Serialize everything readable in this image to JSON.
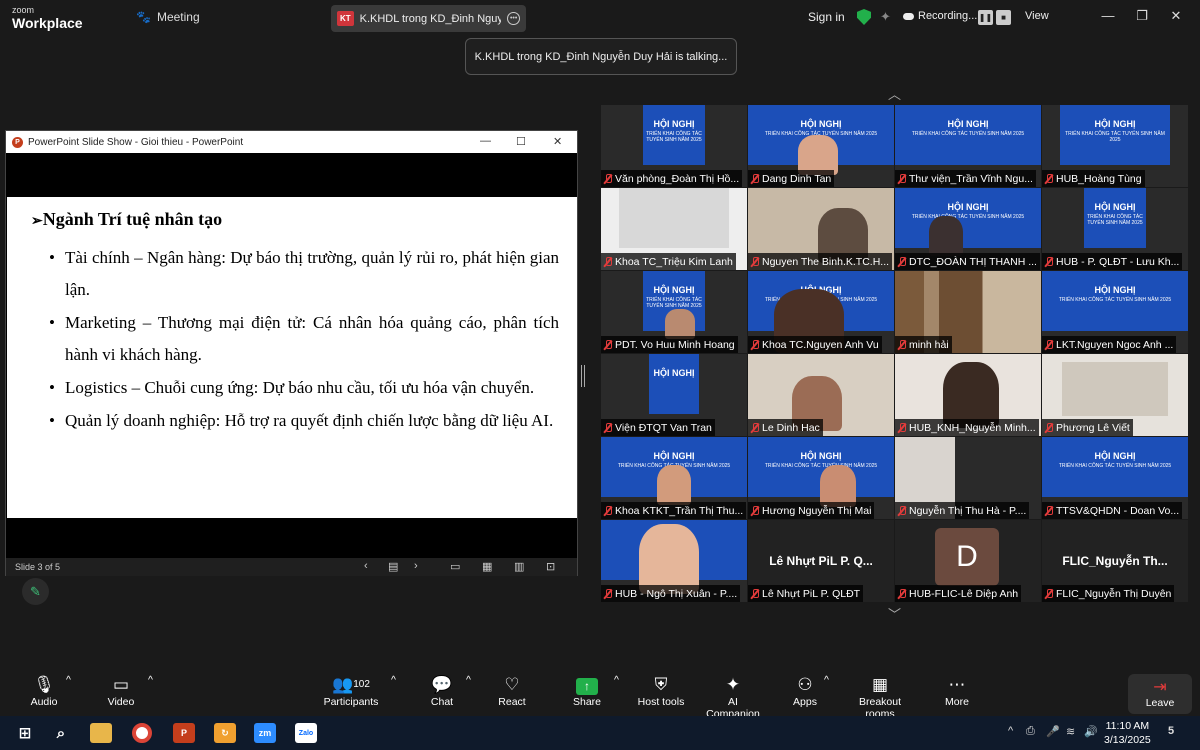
{
  "app": {
    "logo_line1": "zoom",
    "logo_line2": "Workplace",
    "meeting_label": "Meeting",
    "meeting_tab": "K.KHDL trong KD_Đinh Nguyễn Duy Hải",
    "tab_badge": "KT",
    "signin": "Sign in",
    "recording": "Recording...",
    "view": "View",
    "talking": "K.KHDL trong KD_Đinh Nguyễn Duy Hải is talking..."
  },
  "ppt": {
    "title": "PowerPoint Slide Show - Gioi thieu - PowerPoint",
    "slide_status": "Slide 3 of 5",
    "heading": "Ngành Trí tuệ nhân tạo",
    "bullets": [
      "Tài chính – Ngân hàng: Dự báo thị trường, quản lý rủi ro, phát hiện gian lận.",
      "Marketing – Thương mại điện tử: Cá nhân hóa quảng cáo, phân tích hành vi khách hàng.",
      "Logistics – Chuỗi cung ứng: Dự báo nhu cầu, tối ưu hóa vận chuyển.",
      "Quản lý doanh nghiệp: Hỗ trợ ra quyết định chiến lược bằng dữ liệu AI."
    ]
  },
  "banner": {
    "title": "HỘI NGHỊ",
    "subtitle": "TRIỂN KHAI CÔNG TÁC TUYỂN SINH NĂM 2025"
  },
  "participants": [
    "Văn phòng_Đoàn Thị Hồ...",
    "Dang Dinh Tan",
    "Thư viện_Trần Vĩnh Ngu...",
    "HUB_Hoàng Tùng",
    "Khoa TC_Triệu Kim Lanh",
    "Nguyen The Binh.K.TC.H...",
    "DTC_ĐOÀN THỊ THANH ...",
    "HUB - P. QLĐT - Lưu Kh...",
    "PDT. Vo Huu Minh Hoang",
    "Khoa TC.Nguyen Anh Vu",
    "minh hải",
    "LKT.Nguyen Ngoc Anh ...",
    "Viện ĐTQT Van Tran",
    "Le Dinh Hac",
    "HUB_KNH_Nguyễn Minh...",
    "Phương Lê Viết",
    "Khoa KTKT_Trần Thị Thu...",
    "Hương Nguyễn Thị Mai",
    "Nguyễn Thị Thu Hà - P....",
    "TTSV&QHDN - Doan Vo...",
    "HUB - Ngô Thị Xuân - P....",
    "Lê Nhựt PiL P. QLĐT",
    "HUB-FLIC-Lê Diệp Anh",
    "FLIC_Nguyễn Thị Duyên"
  ],
  "big_names": {
    "t22": "Lê Nhựt PiL P. Q...",
    "t24": "FLIC_Nguyễn  Th..."
  },
  "avatar_letter": "D",
  "toolbar": {
    "audio": "Audio",
    "video": "Video",
    "participants": "Participants",
    "participant_count": "102",
    "chat": "Chat",
    "react": "React",
    "share": "Share",
    "host_tools": "Host tools",
    "ai_companion": "AI Companion",
    "apps": "Apps",
    "breakout": "Breakout rooms",
    "more": "More",
    "leave": "Leave"
  },
  "taskbar": {
    "time": "11:10 AM",
    "date": "3/13/2025",
    "notif_count": "5",
    "zalo": "Zalo",
    "zoom_icon": "zm"
  }
}
